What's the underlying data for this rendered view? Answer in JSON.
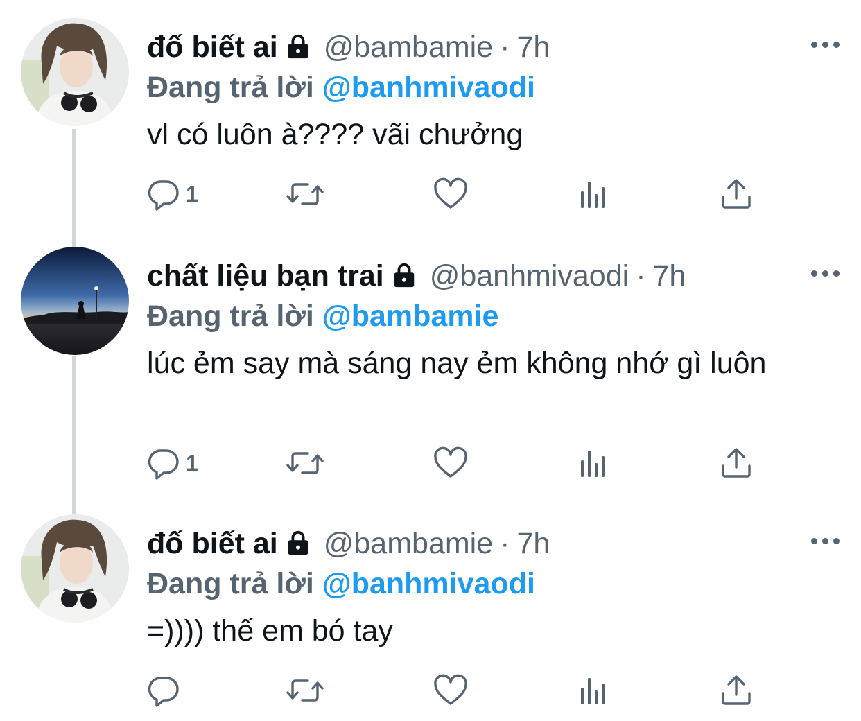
{
  "colors": {
    "text": "#0f1419",
    "secondary": "#566370",
    "accent": "#1d9bf0",
    "thread_line": "#d2d6d9"
  },
  "tweets": [
    {
      "name": "đố biết ai",
      "handle": "@bambamie",
      "separator": "·",
      "time": "7h",
      "reply_prefix": "Đang trả lời",
      "reply_to": "@banhmivaodi",
      "text": "vl có luôn à???? vãi chưởng",
      "reply_count": "1",
      "avatar": "boy-with-headphones"
    },
    {
      "name": "chất liệu bạn trai",
      "handle": "@banhmivaodi",
      "separator": "·",
      "time": "7h",
      "reply_prefix": "Đang trả lời",
      "reply_to": "@bambamie",
      "text": "lúc ẻm say mà sáng nay ẻm không nhớ gì luôn",
      "reply_count": "1",
      "avatar": "night-street"
    },
    {
      "name": "đố biết ai",
      "handle": "@bambamie",
      "separator": "·",
      "time": "7h",
      "reply_prefix": "Đang trả lời",
      "reply_to": "@banhmivaodi",
      "text": "=)))) thế em bó tay",
      "reply_count": "",
      "avatar": "boy-with-headphones"
    }
  ],
  "icons": [
    "lock-icon",
    "more-icon",
    "reply-icon",
    "retweet-icon",
    "like-icon",
    "analytics-icon",
    "share-icon"
  ]
}
